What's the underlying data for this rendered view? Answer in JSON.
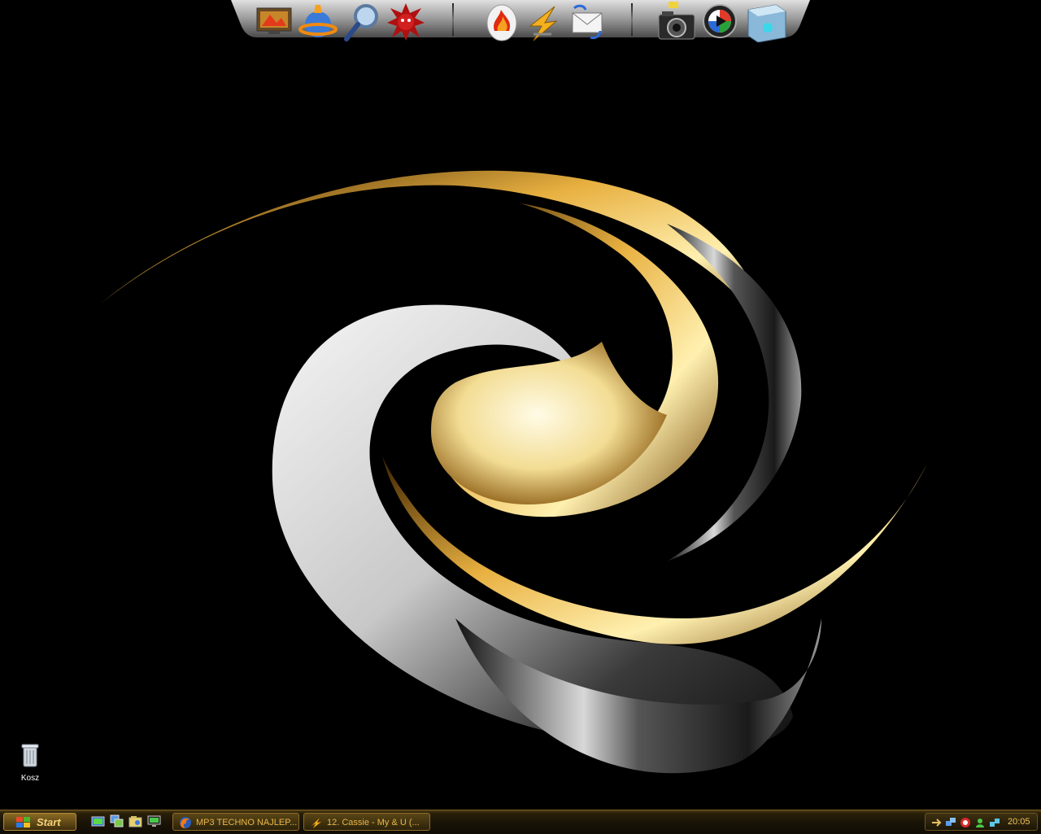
{
  "desktop": {
    "icons": [
      {
        "label": "Kosz",
        "icon": "recycle-bin-icon"
      }
    ]
  },
  "dock": {
    "icons": [
      "desktop-picture-icon",
      "globe-rocket-icon",
      "magnifier-icon",
      "red-virus-icon",
      "fire-egg-icon",
      "lightning-app-icon",
      "mail-sync-icon",
      "camera-icon",
      "media-player-icon",
      "screen-cube-icon"
    ]
  },
  "taskbar": {
    "start_label": "Start",
    "quick_launch": [
      "show-desktop-icon",
      "window-switch-icon",
      "explorer-icon",
      "display-icon"
    ],
    "tasks": [
      {
        "label": "MP3 TECHNO NAJLEP...",
        "icon": "firefox-icon"
      },
      {
        "label": "12. Cassie - My & U (...",
        "icon": "winamp-icon"
      }
    ],
    "tray_icons": [
      "arrow-icon",
      "network-icon",
      "antivirus-icon",
      "messenger-icon",
      "connection-icon"
    ],
    "clock": "20:05"
  },
  "colors": {
    "accent": "#e8b648",
    "taskbar": "#1a1407",
    "desktop_bg": "#000000"
  }
}
